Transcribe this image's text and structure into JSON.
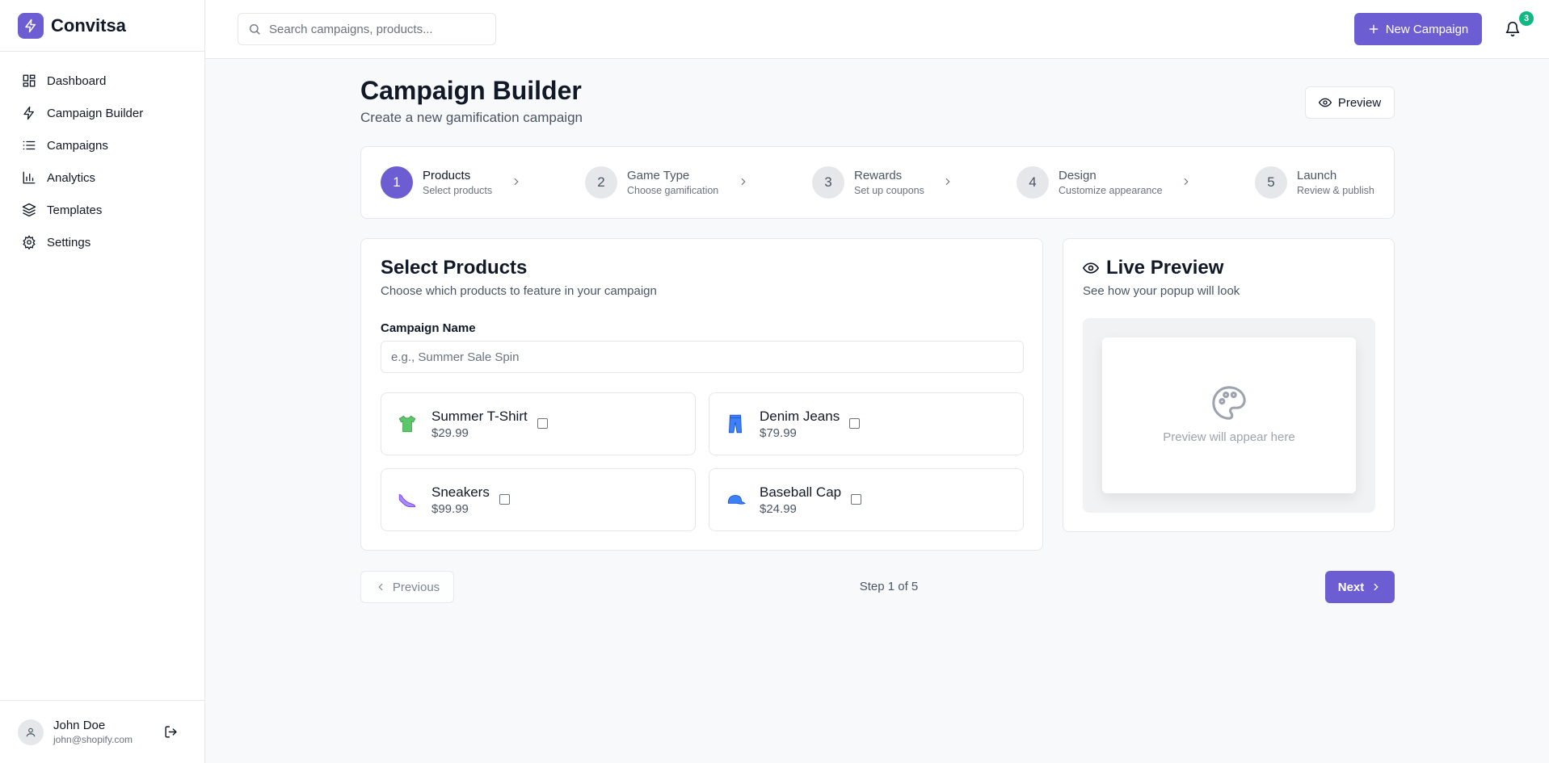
{
  "app": {
    "name": "Convitsa"
  },
  "sidebar": {
    "items": [
      {
        "label": "Dashboard",
        "icon": "dashboard-icon"
      },
      {
        "label": "Campaign Builder",
        "icon": "lightning-icon"
      },
      {
        "label": "Campaigns",
        "icon": "list-icon"
      },
      {
        "label": "Analytics",
        "icon": "bar-chart-icon"
      },
      {
        "label": "Templates",
        "icon": "layers-icon"
      },
      {
        "label": "Settings",
        "icon": "gear-icon"
      }
    ],
    "user": {
      "name": "John Doe",
      "email": "john@shopify.com"
    }
  },
  "topbar": {
    "search_placeholder": "Search campaigns, products...",
    "new_campaign_label": "New Campaign",
    "notification_count": "3"
  },
  "page": {
    "title": "Campaign Builder",
    "subtitle": "Create a new gamification campaign",
    "preview_label": "Preview"
  },
  "steps": [
    {
      "number": "1",
      "title": "Products",
      "subtitle": "Select products",
      "active": true
    },
    {
      "number": "2",
      "title": "Game Type",
      "subtitle": "Choose gamification",
      "active": false
    },
    {
      "number": "3",
      "title": "Rewards",
      "subtitle": "Set up coupons",
      "active": false
    },
    {
      "number": "4",
      "title": "Design",
      "subtitle": "Customize appearance",
      "active": false
    },
    {
      "number": "5",
      "title": "Launch",
      "subtitle": "Review & publish",
      "active": false
    }
  ],
  "products_card": {
    "title": "Select Products",
    "description": "Choose which products to feature in your campaign",
    "campaign_name_label": "Campaign Name",
    "campaign_name_placeholder": "e.g., Summer Sale Spin",
    "campaign_name_value": "",
    "products": [
      {
        "name": "Summer T-Shirt",
        "price": "$29.99",
        "icon": "tshirt-icon",
        "checked": false
      },
      {
        "name": "Denim Jeans",
        "price": "$79.99",
        "icon": "jeans-icon",
        "checked": false
      },
      {
        "name": "Sneakers",
        "price": "$99.99",
        "icon": "sneaker-icon",
        "checked": false
      },
      {
        "name": "Baseball Cap",
        "price": "$24.99",
        "icon": "cap-icon",
        "checked": false
      }
    ]
  },
  "live_preview": {
    "title": "Live Preview",
    "description": "See how your popup will look",
    "placeholder": "Preview will appear here"
  },
  "footer_nav": {
    "previous_label": "Previous",
    "step_indicator": "Step 1 of 5",
    "next_label": "Next"
  },
  "colors": {
    "accent": "#6c5dd3",
    "badge": "#10b981",
    "border": "#e5e7eb",
    "background": "#f8f9fb"
  }
}
